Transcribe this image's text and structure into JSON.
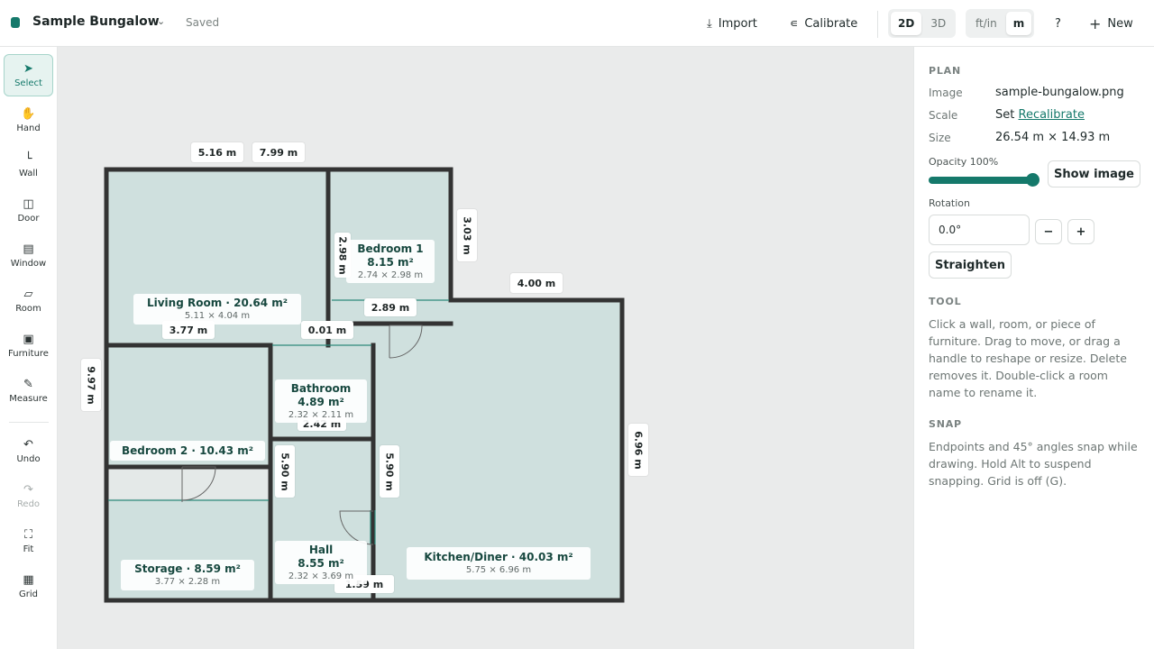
{
  "header": {
    "title": "Sample Bungalow",
    "saved": "Saved",
    "import": "Import",
    "calibrate": "Calibrate",
    "view2d": "2D",
    "view3d": "3D",
    "unit_imperial": "ft/in",
    "unit_metric": "m",
    "help": "?",
    "new": "New"
  },
  "tools": [
    {
      "label": "Select",
      "icon": "cursor-icon"
    },
    {
      "label": "Hand",
      "icon": "hand-icon"
    },
    {
      "label": "Wall",
      "icon": "wall-icon"
    },
    {
      "label": "Door",
      "icon": "door-icon"
    },
    {
      "label": "Window",
      "icon": "window-icon"
    },
    {
      "label": "Room",
      "icon": "room-icon"
    },
    {
      "label": "Furniture",
      "icon": "sofa-icon"
    },
    {
      "label": "Measure",
      "icon": "ruler-icon"
    },
    {
      "label": "Undo",
      "icon": "undo-icon"
    },
    {
      "label": "Redo",
      "icon": "redo-icon"
    },
    {
      "label": "Fit",
      "icon": "fit-icon"
    },
    {
      "label": "Grid",
      "icon": "grid-icon"
    }
  ],
  "plan": {
    "rooms": [
      {
        "name": "Living Room · 20.64 m²",
        "size": "5.11 × 4.04 m"
      },
      {
        "name": "Bedroom 1",
        "area": "8.15 m²",
        "size": "2.74 × 2.98 m"
      },
      {
        "name": "Bathroom",
        "area": "4.89 m²",
        "size": "2.32 × 2.11 m"
      },
      {
        "name": "Bedroom 2 · 10.43 m²"
      },
      {
        "name": "Storage · 8.59 m²",
        "size": "3.77 × 2.28 m"
      },
      {
        "name": "Hall",
        "area": "8.55 m²",
        "size": "2.32 × 3.69 m"
      },
      {
        "name": "Kitchen/Diner · 40.03 m²",
        "size": "5.75 × 6.96 m"
      }
    ],
    "dimensions": {
      "top_left": "5.16 m",
      "top_mid": "7.99 m",
      "bed1_right": "3.03 m",
      "kitchen_top": "4.00 m",
      "bed1_bottom": "2.89 m",
      "living_bottom": "3.77 m",
      "gap": "0.01 m",
      "left_total": "9.97 m",
      "right_total": "6.96 m",
      "hall_left": "5.90 m",
      "hall_right": "5.90 m",
      "hall_bottom": "1.59 m",
      "bath_hidden": "2.42 m",
      "bed1_hidden": "2.98 m"
    }
  },
  "panel": {
    "plan_title": "PLAN",
    "image_label": "Image",
    "image_value": "sample-bungalow.png",
    "scale_label": "Scale",
    "scale_set": "Set",
    "scale_link": "Recalibrate",
    "size_label": "Size",
    "size_value": "26.54 m × 14.93 m",
    "opacity_label": "Opacity 100%",
    "opacity": 1.0,
    "show_image": "Show image",
    "rotation_label": "Rotation",
    "rotation_value": "0.0°",
    "minus": "−",
    "plus": "+",
    "straighten": "Straighten",
    "tool_title": "TOOL",
    "tool_desc": "Click a wall, room, or piece of furniture. Drag to move, or drag a handle to reshape or resize. Delete removes it. Double-click a room name to rename it.",
    "snap_title": "SNAP",
    "snap_desc": "Endpoints and 45° angles snap while drawing. Hold Alt to suspend snapping. Grid is off (G)."
  },
  "colors": {
    "accent": "#15796b",
    "room_fill": "#cfe0de",
    "wall": "#333333",
    "canvas": "#eaebeb"
  }
}
